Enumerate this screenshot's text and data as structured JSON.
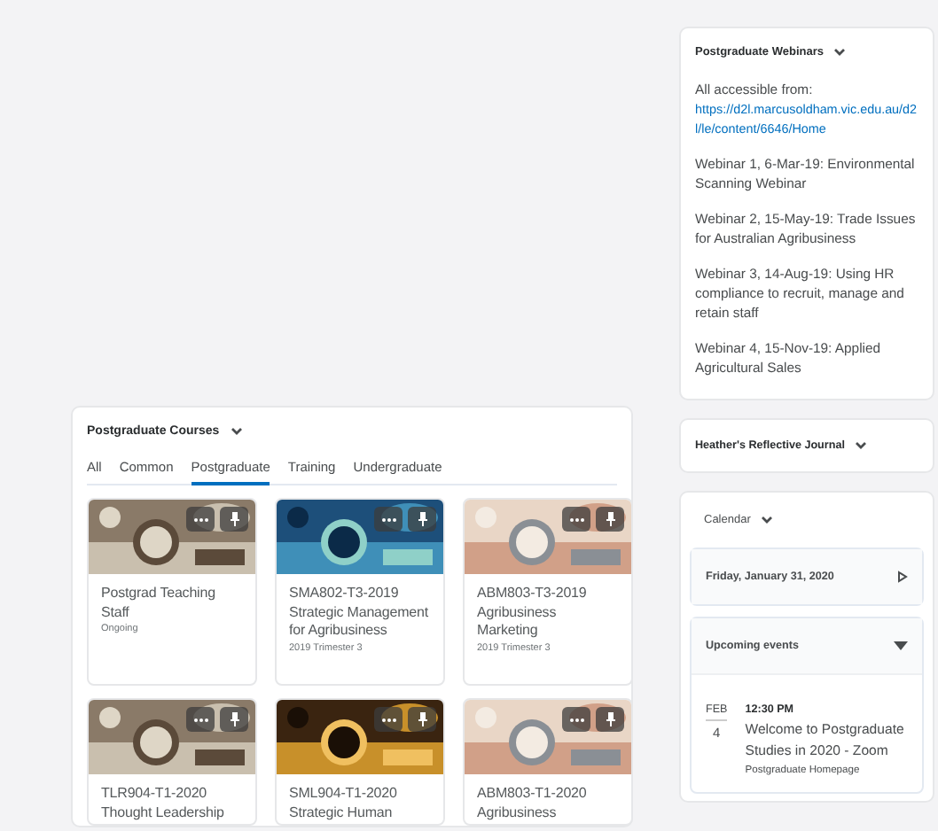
{
  "courses_widget": {
    "title": "Postgraduate Courses",
    "tabs": [
      {
        "label": "All",
        "selected": false
      },
      {
        "label": "Common",
        "selected": false
      },
      {
        "label": "Postgraduate",
        "selected": true
      },
      {
        "label": "Training",
        "selected": false
      },
      {
        "label": "Undergraduate",
        "selected": false
      }
    ],
    "courses": [
      {
        "title": "Postgrad Teaching Staff",
        "subtitle": "Ongoing"
      },
      {
        "title": "SMA802-T3-2019 Strategic Management for Agribusiness",
        "subtitle": "2019 Trimester 3"
      },
      {
        "title": "ABM803-T3-2019 Agribusiness Marketing",
        "subtitle": "2019 Trimester 3"
      },
      {
        "title": "TLR904-T1-2020 Thought Leadership"
      },
      {
        "title": "SML904-T1-2020 Strategic Human"
      },
      {
        "title": "ABM803-T1-2020 Agribusiness"
      }
    ]
  },
  "webinars": {
    "title": "Postgraduate Webinars",
    "intro": "All accessible from:",
    "link": "https://d2l.marcusoldham.vic.edu.au/d2l/le/content/6646/Home",
    "items": [
      "Webinar 1, 6-Mar-19: Environmental Scanning Webinar",
      "Webinar 2, 15-May-19: Trade Issues for Australian Agribusiness",
      "Webinar 3, 14-Aug-19: Using HR compliance to recruit, manage and retain staff",
      "Webinar 4, 15-Nov-19: Applied Agricultural Sales"
    ]
  },
  "journal": {
    "title": "Heather's Reflective Journal"
  },
  "calendar": {
    "title": "Calendar",
    "date": "Friday, January 31, 2020",
    "upcoming": "Upcoming events",
    "events": [
      {
        "month": "FEB",
        "day": "4",
        "time": "12:30 PM",
        "title": "Welcome to Postgraduate Studies in 2020 - Zoom",
        "source": "Postgraduate Homepage"
      }
    ]
  }
}
